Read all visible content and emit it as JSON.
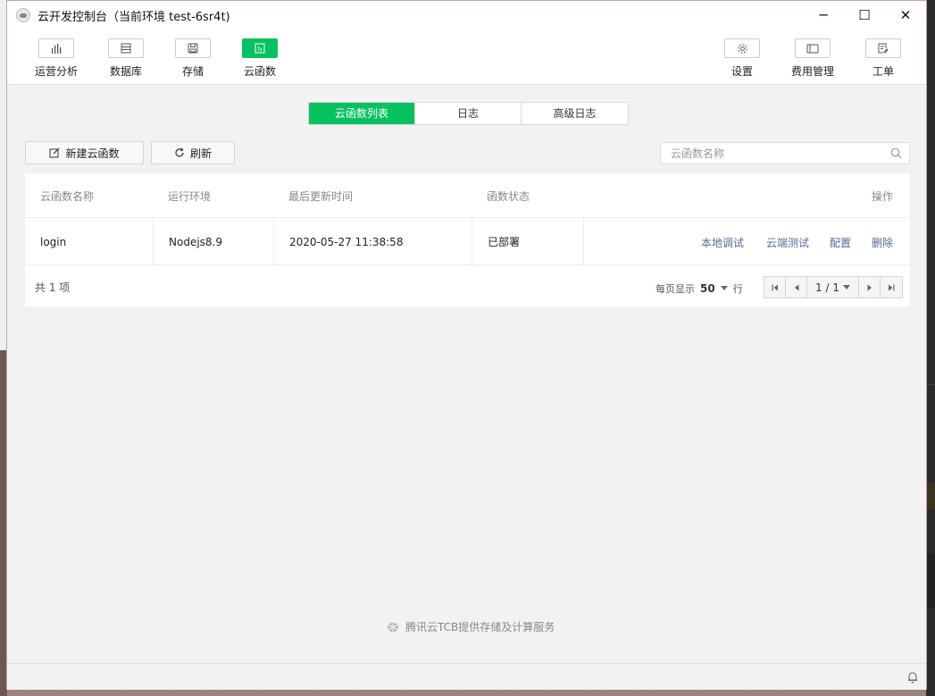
{
  "window": {
    "title": "云开发控制台（当前环境 test-6sr4t)",
    "controls": [
      "─",
      "☐",
      "✕"
    ]
  },
  "toolbar": {
    "left": [
      {
        "label": "运营分析",
        "icon": "bar-chart-icon"
      },
      {
        "label": "数据库",
        "icon": "database-icon"
      },
      {
        "label": "存储",
        "icon": "storage-icon"
      },
      {
        "label": "云函数",
        "icon": "function-icon",
        "active": true
      }
    ],
    "right": [
      {
        "label": "设置",
        "icon": "gear-icon"
      },
      {
        "label": "费用管理",
        "icon": "billing-icon"
      },
      {
        "label": "工单",
        "icon": "ticket-icon"
      }
    ]
  },
  "tabs": [
    {
      "label": "云函数列表",
      "active": true
    },
    {
      "label": "日志"
    },
    {
      "label": "高级日志"
    }
  ],
  "actions": {
    "new_function": "新建云函数",
    "refresh": "刷新"
  },
  "search": {
    "placeholder": "云函数名称",
    "value": ""
  },
  "table": {
    "columns": [
      "云函数名称",
      "运行环境",
      "最后更新时间",
      "函数状态",
      "操作"
    ],
    "rows": [
      {
        "name": "login",
        "runtime": "Nodejs8.9",
        "updated": "2020-05-27 11:38:58",
        "status": "已部署",
        "ops": [
          "本地调试",
          "云端测试",
          "配置",
          "删除"
        ]
      }
    ]
  },
  "pagination": {
    "total": "共 1 项",
    "per_page_label": "每页显示",
    "per_page": "50",
    "per_page_unit": "行",
    "page": "1 / 1"
  },
  "footer": {
    "brand": "腾讯云TCB提供存储及计算服务"
  },
  "colors": {
    "accent": "#07c160",
    "link": "#576b95"
  }
}
